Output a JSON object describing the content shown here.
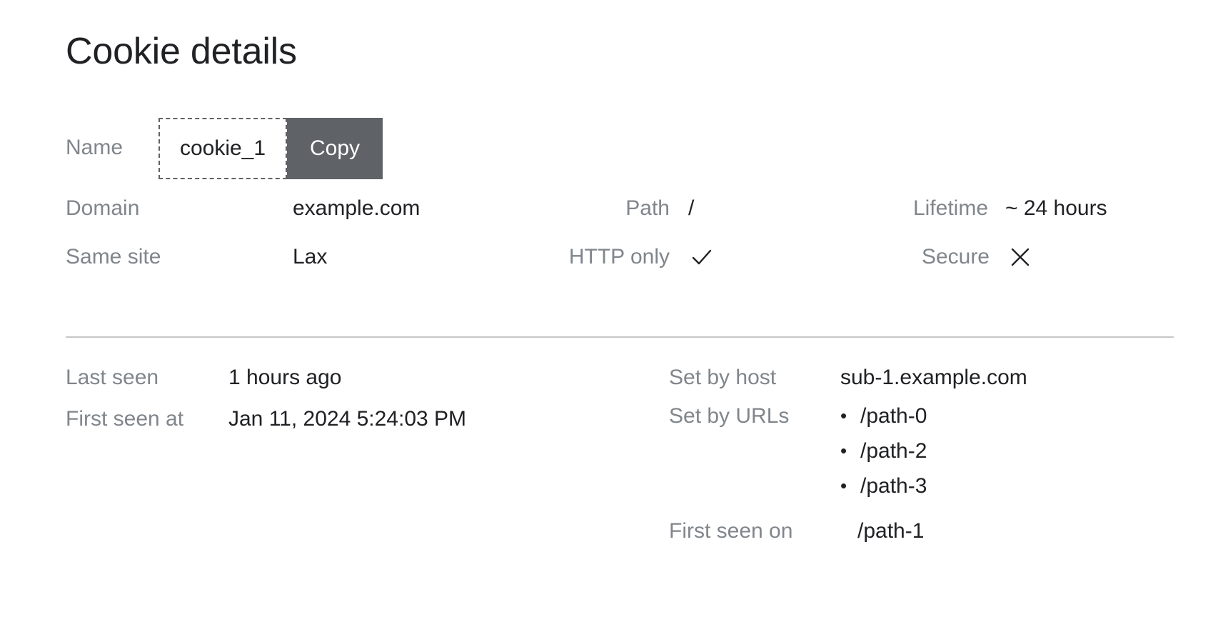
{
  "page": {
    "title": "Cookie details",
    "background": "#ffffff",
    "label_color": "#80868b",
    "value_color": "#202124",
    "button_color": "#5f6368",
    "divider_color": "#c6c6c6"
  },
  "name_field": {
    "label": "Name",
    "value": "cookie_1",
    "copy_label": "Copy"
  },
  "attributes": {
    "domain": {
      "label": "Domain",
      "value": "example.com"
    },
    "path": {
      "label": "Path",
      "value": "/"
    },
    "lifetime": {
      "label": "Lifetime",
      "value": "~ 24 hours"
    },
    "same_site": {
      "label": "Same site",
      "value": "Lax"
    },
    "http_only": {
      "label": "HTTP only",
      "value": "check-icon",
      "state": "true"
    },
    "secure": {
      "label": "Secure",
      "value": "cross-icon",
      "state": "false"
    }
  },
  "details": {
    "last_seen": {
      "label": "Last seen",
      "value": "1 hours ago"
    },
    "first_seen_at": {
      "label": "First seen at",
      "value": "Jan 11, 2024 5:24:03 PM"
    },
    "set_by_host": {
      "label": "Set by host",
      "value": "sub-1.example.com"
    },
    "set_by_urls": {
      "label": "Set by URLs",
      "bullet": "•",
      "items": [
        "/path-0",
        "/path-2",
        "/path-3"
      ]
    },
    "first_seen_on": {
      "label": "First seen on",
      "value": "/path-1"
    }
  }
}
